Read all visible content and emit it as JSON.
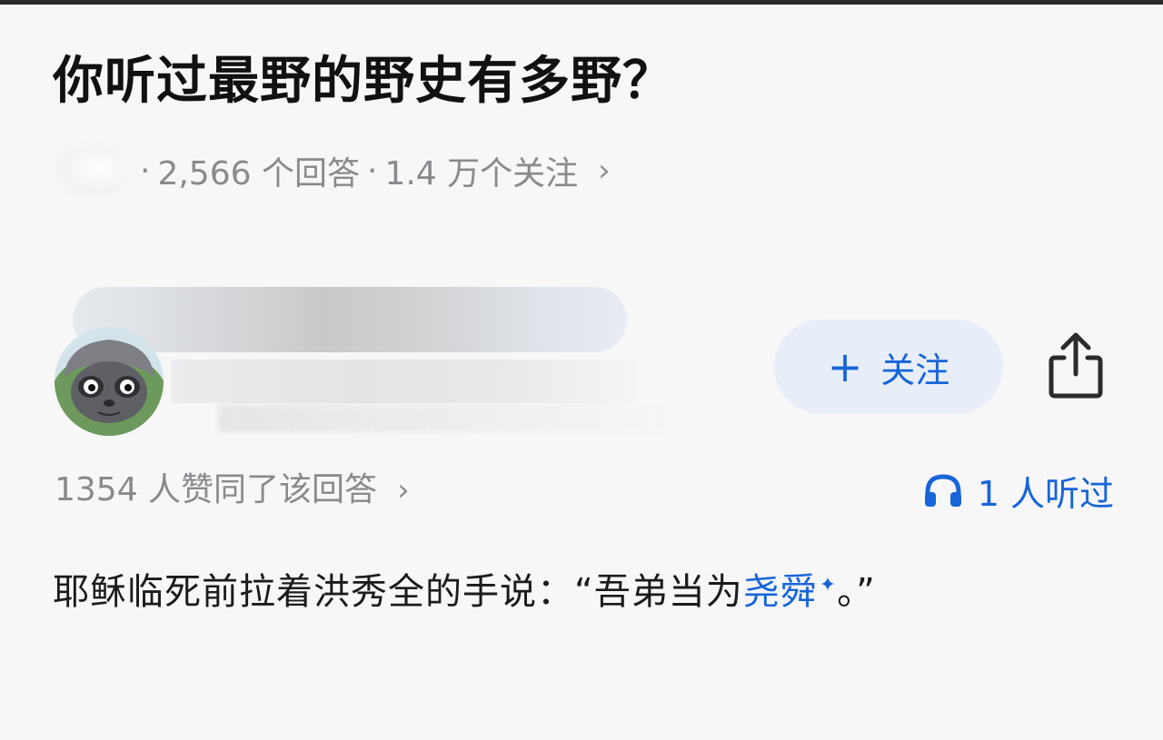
{
  "question": {
    "title": "你听过最野的野史有多野？",
    "meta_sep1": "·",
    "answers": "2,566 个回答",
    "meta_sep2": "·",
    "followers": "1.4 万个关注",
    "chevron": "›"
  },
  "author": {
    "follow_plus": "+",
    "follow_label": "关注"
  },
  "answer": {
    "votes": "1354 人赞同了该回答",
    "votes_chevron": "›",
    "listen_count": "1 人听过",
    "body_before_link": "耶稣临死前拉着洪秀全的手说：“吾弟当为",
    "body_link": "尧舜",
    "body_after_link": "。”",
    "sparkle": "✦"
  },
  "colors": {
    "accent": "#1765d8",
    "follow_bg": "#e7eef8",
    "muted_text": "#8a8a8e",
    "background": "#f7f7f8"
  },
  "icons": {
    "share": "share-icon",
    "headphones": "headphones-icon",
    "sparkle": "sparkle-icon"
  }
}
